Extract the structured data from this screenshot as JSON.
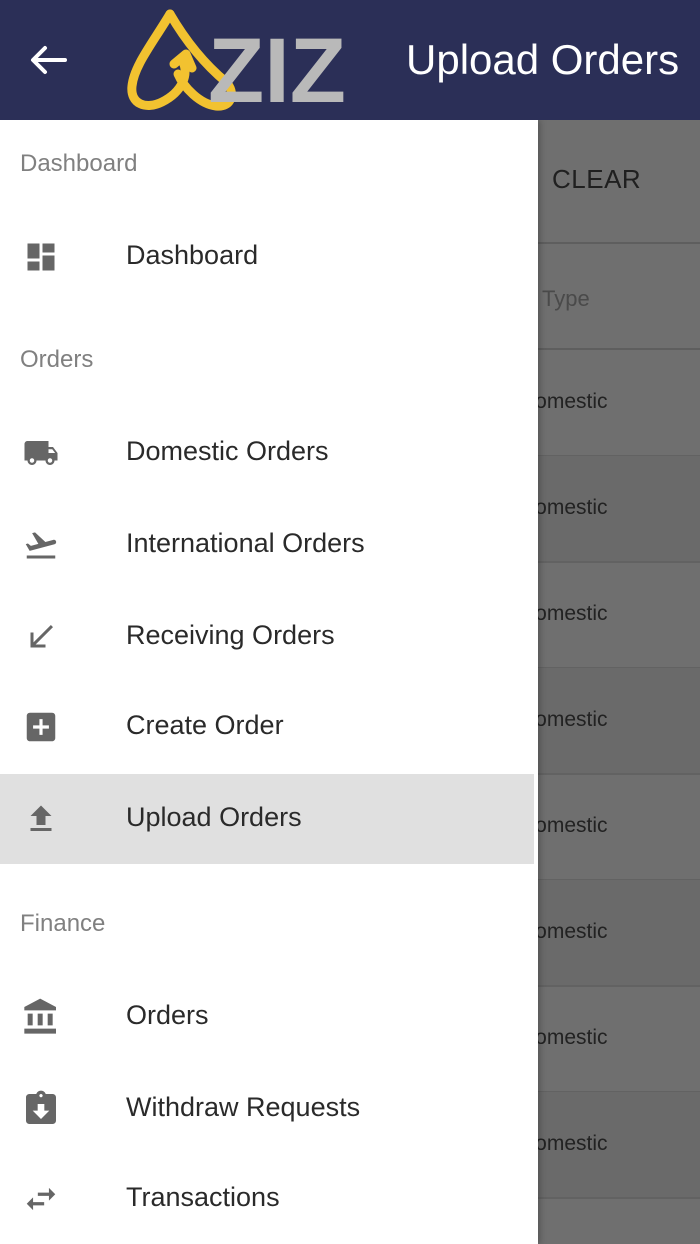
{
  "appbar": {
    "title": "Upload Orders",
    "logo_text": "ZIZ",
    "logo_color": "#f2c230",
    "back_icon": "arrow-left-icon"
  },
  "background_page": {
    "clear_label": "CLEAR",
    "column_header": "Type",
    "row_value": "Domestic",
    "rows": [
      "Domestic",
      "Domestic",
      "Domestic",
      "Domestic",
      "Domestic",
      "Domestic",
      "Domestic",
      "Domestic"
    ]
  },
  "drawer": {
    "sections": {
      "dashboard": "Dashboard",
      "orders": "Orders",
      "finance": "Finance"
    },
    "items": [
      {
        "label": "Dashboard",
        "icon": "dashboard-icon"
      },
      {
        "label": "Domestic Orders",
        "icon": "truck-icon"
      },
      {
        "label": "International Orders",
        "icon": "flight-takeoff-icon"
      },
      {
        "label": "Receiving Orders",
        "icon": "arrow-down-left-icon"
      },
      {
        "label": "Create Order",
        "icon": "add-box-icon"
      },
      {
        "label": "Upload Orders",
        "icon": "upload-icon",
        "active": true
      },
      {
        "label": "Orders",
        "icon": "bank-icon"
      },
      {
        "label": "Withdraw Requests",
        "icon": "clipboard-download-icon"
      },
      {
        "label": "Transactions",
        "icon": "swap-arrows-icon"
      }
    ]
  },
  "colors": {
    "appbar": "#2b2f57",
    "active_item_bg": "#e0e0e0",
    "icon": "#666666"
  }
}
